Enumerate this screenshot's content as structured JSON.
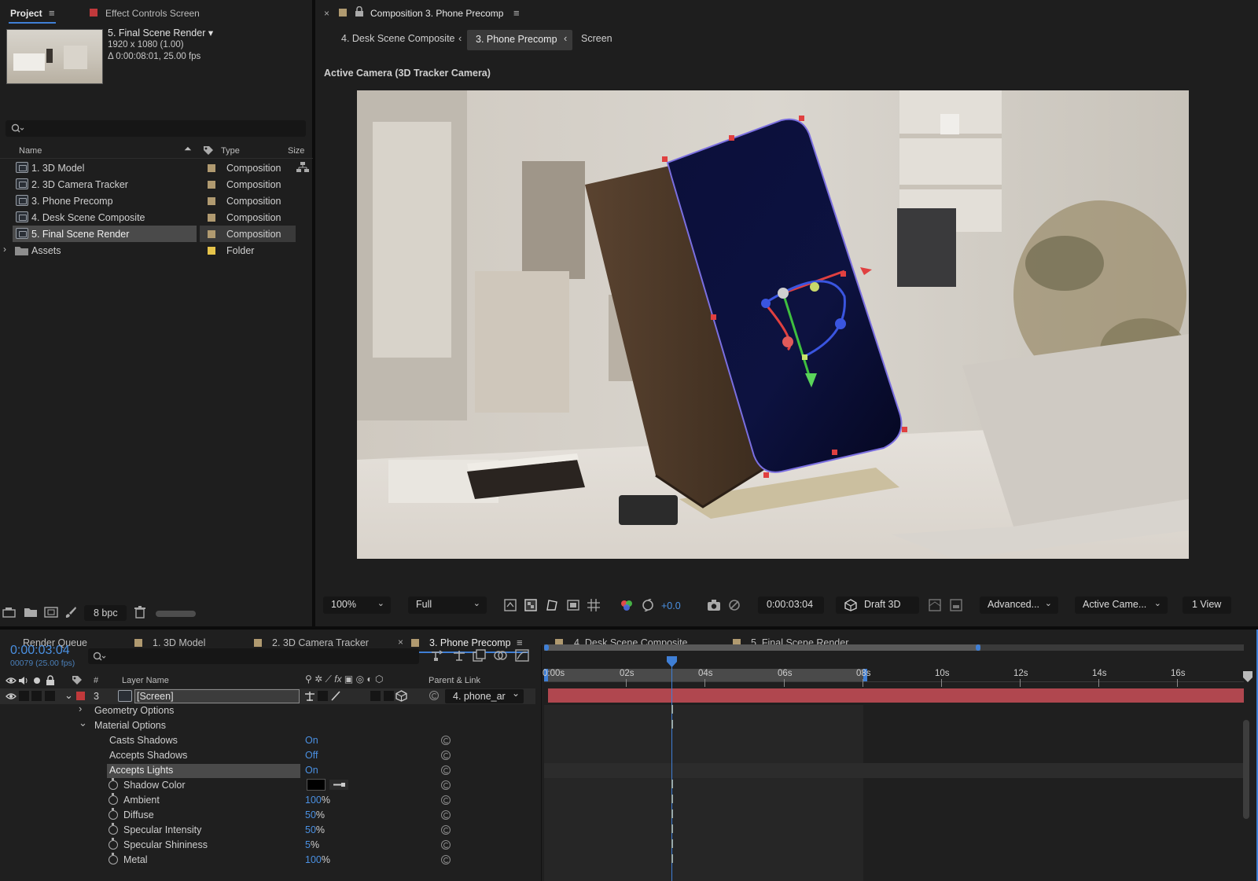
{
  "project_panel": {
    "tab_project": "Project",
    "tab_effect_controls": "Effect Controls Screen",
    "selected_item": {
      "name": "5. Final Scene Render",
      "name_suffix": "▾",
      "resolution": "1920 x 1080 (1.00)",
      "duration": "Δ 0:00:08:01, 25.00 fps"
    },
    "search_placeholder": "",
    "columns": {
      "name": "Name",
      "type": "Type",
      "size": "Size"
    },
    "items": [
      {
        "name": "1. 3D Model",
        "type": "Composition"
      },
      {
        "name": "2. 3D Camera Tracker",
        "type": "Composition"
      },
      {
        "name": "3. Phone Precomp",
        "type": "Composition"
      },
      {
        "name": "4. Desk Scene Composite",
        "type": "Composition"
      },
      {
        "name": "5. Final Scene Render",
        "type": "Composition"
      },
      {
        "name": "Assets",
        "type": "Folder"
      }
    ],
    "footer": {
      "bpc": "8 bpc"
    }
  },
  "viewer": {
    "tab_title": "Composition 3. Phone Precomp",
    "breadcrumbs": [
      "4. Desk Scene Composite",
      "3. Phone Precomp",
      "Screen"
    ],
    "camera_label": "Active Camera (3D Tracker Camera)",
    "toolbar": {
      "zoom": "100%",
      "resolution": "Full",
      "exposure": "+0.0",
      "timecode": "0:00:03:04",
      "renderer": "Draft 3D",
      "advanced": "Advanced...",
      "camera": "Active Came...",
      "views": "1 View"
    }
  },
  "timeline": {
    "tabs": [
      {
        "label": "Render Queue"
      },
      {
        "label": "1. 3D Model"
      },
      {
        "label": "2. 3D Camera Tracker"
      },
      {
        "label": "3. Phone Precomp"
      },
      {
        "label": "4. Desk Scene Composite"
      },
      {
        "label": "5. Final Scene Render"
      }
    ],
    "current_time": "0:00:03:04",
    "frame_info": "00079 (25.00 fps)",
    "headers": {
      "number": "#",
      "layer_name": "Layer Name",
      "parent": "Parent & Link"
    },
    "layer": {
      "number": "3",
      "name": "[Screen]",
      "parent": "4. phone_ar"
    },
    "groups": {
      "geometry": "Geometry Options",
      "material": "Material Options"
    },
    "properties": [
      {
        "name": "Casts Shadows",
        "value": "On",
        "unit": ""
      },
      {
        "name": "Accepts Shadows",
        "value": "Off",
        "unit": ""
      },
      {
        "name": "Accepts Lights",
        "value": "On",
        "unit": ""
      },
      {
        "name": "Shadow Color",
        "value": "",
        "unit": ""
      },
      {
        "name": "Ambient",
        "value": "100",
        "unit": "%"
      },
      {
        "name": "Diffuse",
        "value": "50",
        "unit": "%"
      },
      {
        "name": "Specular Intensity",
        "value": "50",
        "unit": "%"
      },
      {
        "name": "Specular Shininess",
        "value": "5",
        "unit": "%"
      },
      {
        "name": "Metal",
        "value": "100",
        "unit": "%"
      }
    ],
    "ruler": [
      "0:00s",
      "02s",
      "04s",
      "06s",
      "08s",
      "10s",
      "12s",
      "14s",
      "16s"
    ]
  },
  "colors": {
    "accent_blue": "#4a90e2",
    "layer_bar": "#b0474f",
    "label_tan": "#b09a70",
    "folder_yellow": "#e6c44a",
    "red_label": "#c0393b"
  }
}
